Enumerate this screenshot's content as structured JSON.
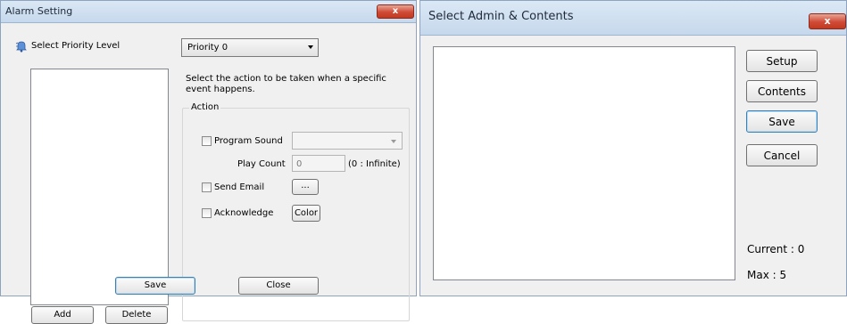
{
  "alarm_window": {
    "title": "Alarm Setting",
    "close_glyph": "x",
    "priority_label": "Select Priority Level",
    "priority_icon": "bell-icon",
    "priority_selected": "Priority 0",
    "description": "Select the action to be taken when a specific event happens.",
    "action_group_label": "Action",
    "program_sound_label": "Program Sound",
    "play_count_label": "Play Count",
    "play_count_value": "0",
    "play_count_hint": "(0 : Infinite)",
    "send_email_label": "Send Email",
    "email_button_label": "...",
    "acknowledge_label": "Acknowledge",
    "color_button_label": "Color",
    "add_button": "Add",
    "delete_button": "Delete",
    "save_button": "Save",
    "close_button": "Close"
  },
  "select_window": {
    "title": "Select Admin & Contents",
    "close_glyph": "x",
    "setup_button": "Setup",
    "contents_button": "Contents",
    "save_button": "Save",
    "cancel_button": "Cancel",
    "current_label": "Current : 0",
    "max_label": "Max : 5"
  }
}
